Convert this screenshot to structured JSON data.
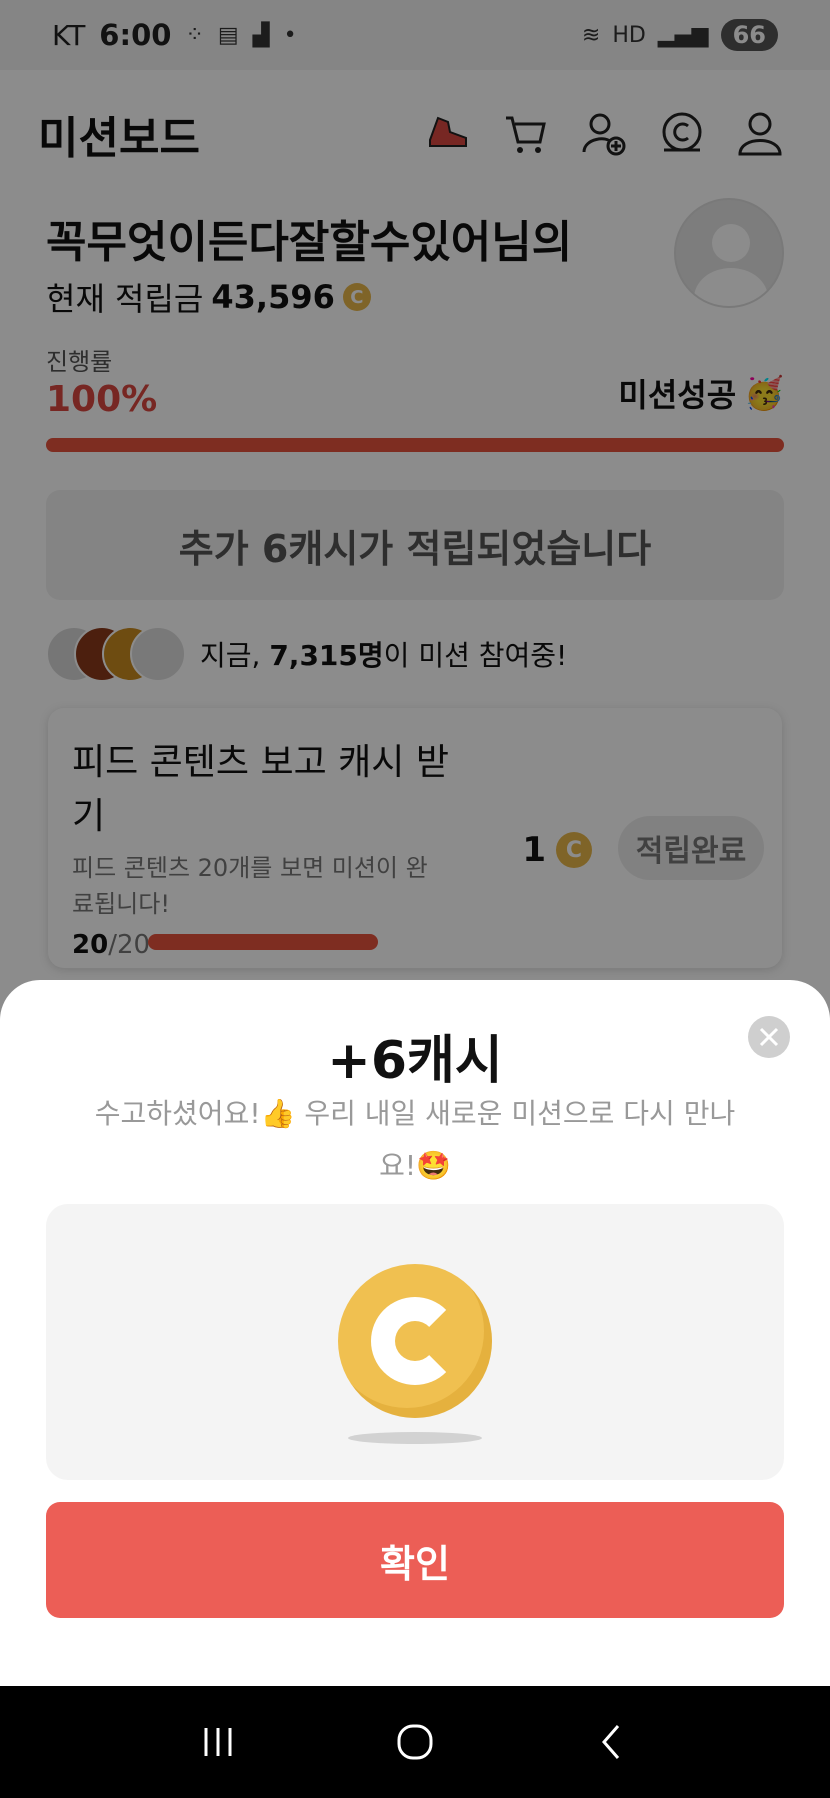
{
  "status_bar": {
    "carrier": "KT",
    "time": "6:00",
    "battery": "66"
  },
  "header": {
    "title": "미션보드",
    "icons": [
      "sneaker-icon",
      "cart-icon",
      "add-friend-icon",
      "coin-icon",
      "profile-icon"
    ]
  },
  "greeting": {
    "name": "꼭무엇이든다잘할수있어님의",
    "balance_label": "현재 적립금",
    "balance_value": "43,596"
  },
  "progress": {
    "label": "진행률",
    "percent_text": "100%",
    "percent_value": 100,
    "status": "미션성공",
    "status_emoji": "🥳"
  },
  "notice": "추가 6캐시가 적립되었습니다",
  "participants": {
    "prefix": "지금, ",
    "count": "7,315명",
    "suffix": "이 미션 참여중!"
  },
  "mission": {
    "title": "피드 콘텐츠 보고 캐시 받기",
    "description": "피드 콘텐츠 20개를 보면 미션이 완료됩니다!",
    "reward": "1",
    "button": "적립완료",
    "count_done": "20",
    "count_total": "/20"
  },
  "sheet": {
    "title": "+6캐시",
    "message": "수고하셨어요!👍 우리 내일 새로운 미션으로 다시 만나요!🤩",
    "confirm_label": "확인"
  },
  "colors": {
    "accent": "#ec5e56",
    "progress": "#e5533d",
    "coin": "#f0c050"
  }
}
